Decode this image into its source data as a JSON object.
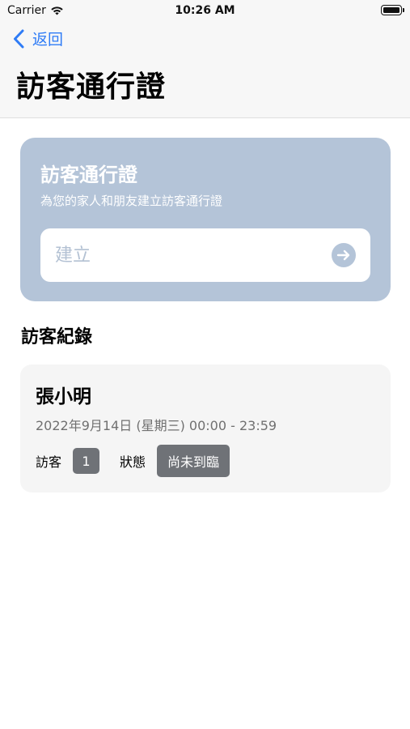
{
  "status_bar": {
    "carrier": "Carrier",
    "time": "10:26 AM",
    "wifi_icon": "wifi-icon",
    "battery_icon": "battery-icon"
  },
  "nav": {
    "back_label": "返回",
    "back_icon": "chevron-left-icon",
    "title": "訪客通行證"
  },
  "pass_card": {
    "title": "訪客通行證",
    "subtitle": "為您的家人和朋友建立訪客通行證",
    "input_value": "",
    "input_placeholder": "建立",
    "submit_icon": "arrow-right-circle-icon"
  },
  "records_section": {
    "title": "訪客紀錄"
  },
  "records": [
    {
      "name": "張小明",
      "date": "2022年9月14日 (星期三) 00:00 - 23:59",
      "visitors_label": "訪客",
      "visitors_count": "1",
      "status_label": "狀態",
      "status_value": "尚未到臨"
    }
  ],
  "colors": {
    "accent": "#2f7cf6",
    "card_background": "#b4c4d8",
    "badge_background": "#6f7277",
    "record_background": "#f5f5f5"
  }
}
